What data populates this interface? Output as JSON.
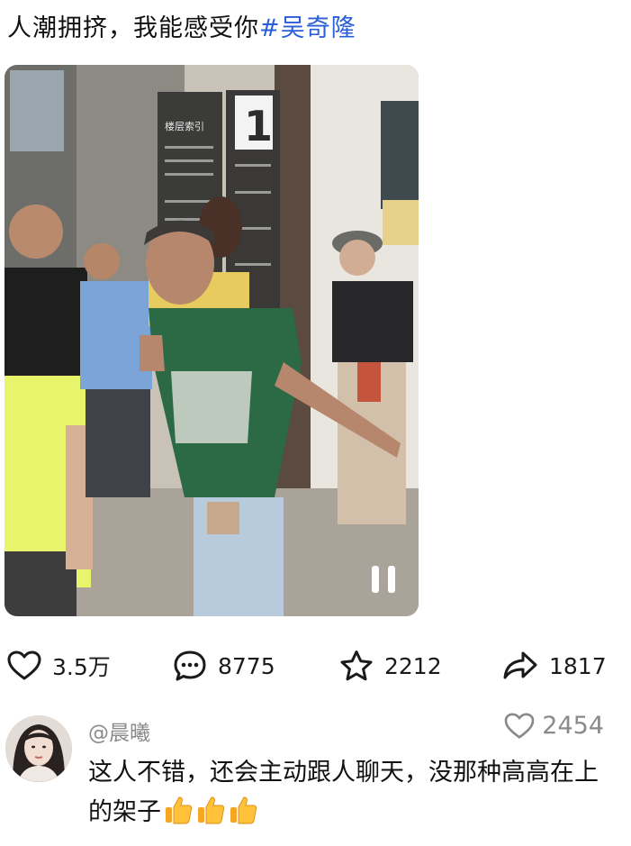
{
  "post": {
    "text": "人潮拥挤，我能感受你",
    "hashtag": "#吴奇隆"
  },
  "media": {
    "type": "video",
    "state": "paused",
    "control_icon": "pause-icon",
    "sign_number": "1",
    "sign_header": "楼层索引"
  },
  "actions": {
    "likes": "3.5万",
    "comments": "8775",
    "favorites": "2212",
    "shares": "1817"
  },
  "comment": {
    "username": "@晨曦",
    "likes": "2454",
    "text": "这人不错，还会主动跟人聊天，没那种高高在上的架子",
    "emoji": [
      "thumbs-up",
      "thumbs-up",
      "thumbs-up"
    ]
  },
  "colors": {
    "hashtag": "#2b5fd9",
    "muted": "#8a8a8a"
  }
}
